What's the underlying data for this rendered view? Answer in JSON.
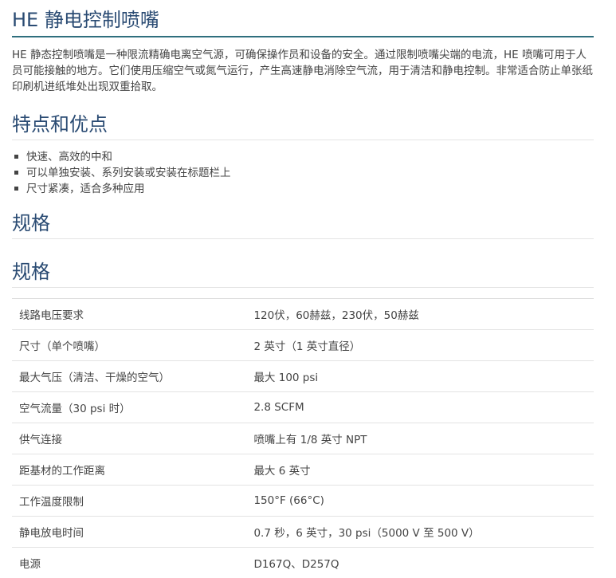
{
  "title": "HE 静电控制喷嘴",
  "intro": "HE 静态控制喷嘴是一种限流精确电离空气源，可确保操作员和设备的安全。通过限制喷嘴尖端的电流，HE 喷嘴可用于人员可能接触的地方。它们使用压缩空气或氮气运行，产生高速静电消除空气流，用于清洁和静电控制。非常适合防止单张纸印刷机进纸堆处出现双重拾取。",
  "features": {
    "heading": "特点和优点",
    "items": [
      "快速、高效的中和",
      "可以单独安装、系列安装或安装在标题栏上",
      "尺寸紧凑，适合多种应用"
    ]
  },
  "specs_heading_1": "规格",
  "specs_heading_2": "规格",
  "specs": [
    {
      "label": "线路电压要求",
      "value": "120伏，60赫兹，230伏，50赫兹"
    },
    {
      "label": "尺寸（单个喷嘴）",
      "value": "2 英寸（1 英寸直径）"
    },
    {
      "label": "最大气压（清洁、干燥的空气）",
      "value": "最大 100 psi"
    },
    {
      "label": "空气流量（30 psi 时）",
      "value": "2.8 SCFM"
    },
    {
      "label": "供气连接",
      "value": "喷嘴上有 1/8 英寸 NPT"
    },
    {
      "label": "距基材的工作距离",
      "value": "最大 6 英寸"
    },
    {
      "label": "工作温度限制",
      "value": "150°F (66°C)"
    },
    {
      "label": "静电放电时间",
      "value": "0.7 秒，6 英寸，30 psi（5000 V 至 500 V）"
    },
    {
      "label": "电源",
      "value": "D167Q、D257Q"
    }
  ]
}
